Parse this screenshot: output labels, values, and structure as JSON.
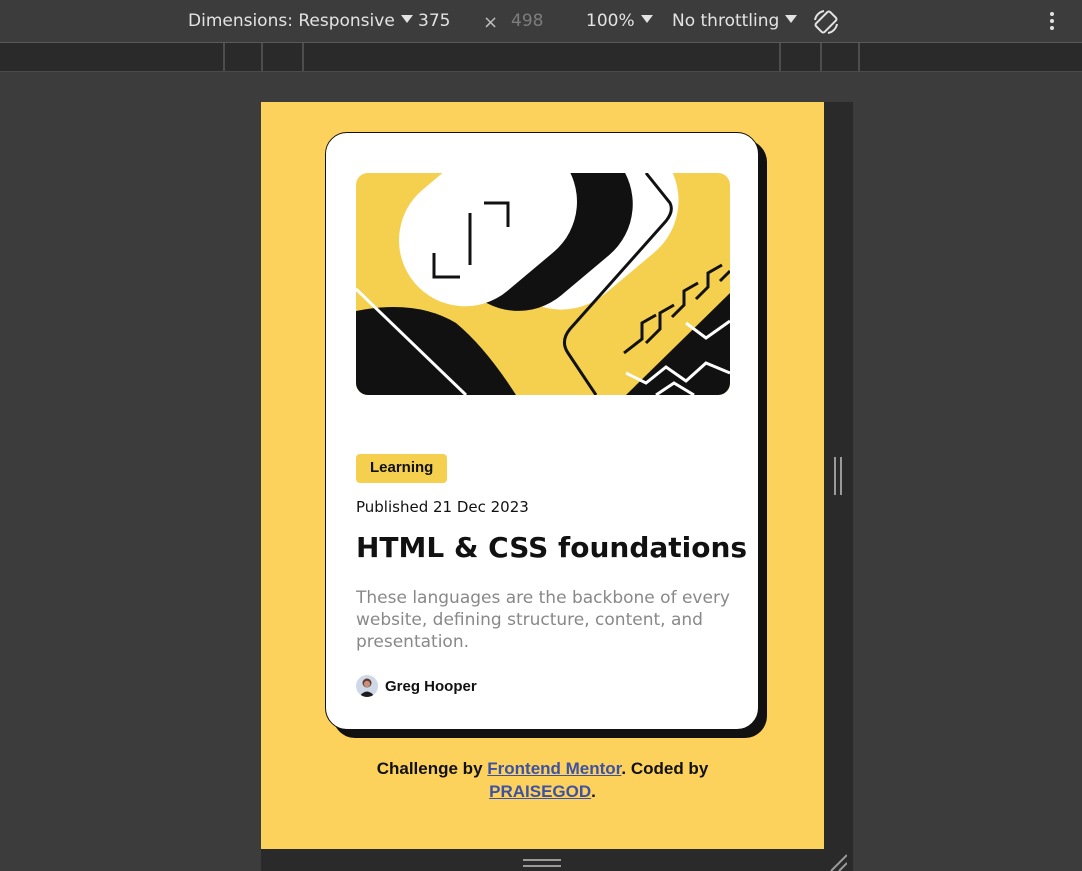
{
  "toolbar": {
    "dimensions_label": "Dimensions: Responsive",
    "width": "375",
    "times": "×",
    "height": "498",
    "zoom": "100%",
    "throttling": "No throttling",
    "rotate_icon": "rotate-icon",
    "more_icon": "more-vertical-icon"
  },
  "card": {
    "tag": "Learning",
    "published": "Published 21 Dec 2023",
    "title": "HTML & CSS foundations",
    "description": "These languages are the backbone of every website, defining structure, content, and presentation.",
    "author": "Greg Hooper"
  },
  "attribution": {
    "prefix": "Challenge by",
    "link1": "Frontend Mentor",
    "middle": ". Coded by",
    "link2": "PRAISEGOD",
    "suffix": "."
  },
  "colors": {
    "page_background": "#fdd25c",
    "tag_background": "#f4d04e",
    "link": "#3e52a3",
    "devtools_background": "#3c3c3c"
  }
}
